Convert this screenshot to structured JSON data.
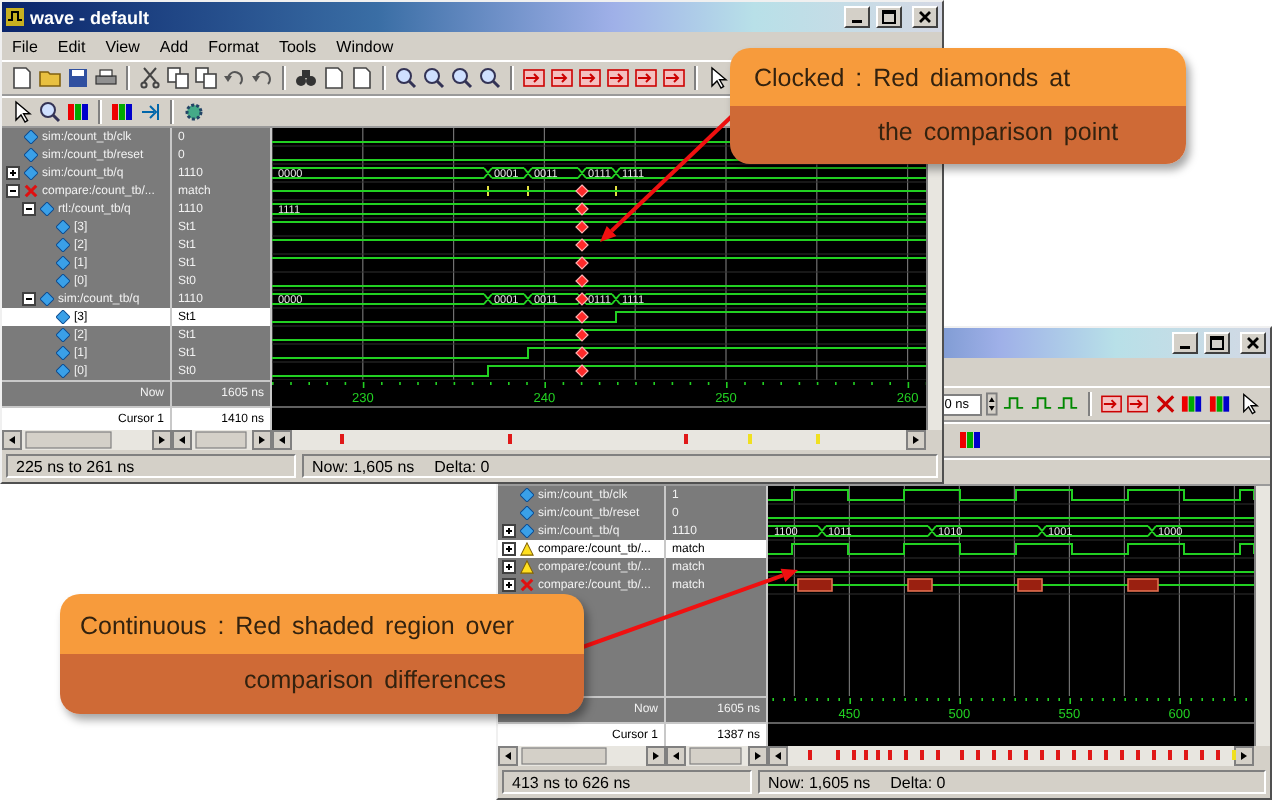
{
  "windows": [
    {
      "kind": "front",
      "title": "wave - default",
      "menu": [
        "File",
        "Edit",
        "View",
        "Add",
        "Format",
        "Tools",
        "Window"
      ],
      "signals": [
        {
          "name": "sim:/count_tb/clk",
          "value": "0",
          "kind": "signal",
          "selected": false
        },
        {
          "name": "sim:/count_tb/reset",
          "value": "0",
          "kind": "signal",
          "selected": false
        },
        {
          "name": "sim:/count_tb/q",
          "value": "1110",
          "kind": "signal",
          "expanded": false,
          "selected": false,
          "wave_labels": [
            "0000",
            "0001",
            "0011",
            "0111",
            "1111"
          ]
        },
        {
          "name": "compare:/count_tb/...",
          "value": "match",
          "kind": "error",
          "expanded": true,
          "selected": false,
          "children": [
            {
              "name": "rtl:/count_tb/q",
              "value": "1110",
              "kind": "signal",
              "expanded": true,
              "selected": false,
              "wave_labels": [
                "1111"
              ],
              "children": [
                {
                  "name": "[3]",
                  "value": "St1",
                  "kind": "signal",
                  "selected": false
                },
                {
                  "name": "[2]",
                  "value": "St1",
                  "kind": "signal",
                  "selected": false
                },
                {
                  "name": "[1]",
                  "value": "St1",
                  "kind": "signal",
                  "selected": false
                },
                {
                  "name": "[0]",
                  "value": "St0",
                  "kind": "signal",
                  "selected": false
                }
              ]
            },
            {
              "name": "sim:/count_tb/q",
              "value": "1110",
              "kind": "signal",
              "expanded": true,
              "selected": false,
              "wave_labels": [
                "0000",
                "0001",
                "0011",
                "0111",
                "1111"
              ],
              "children": [
                {
                  "name": "[3]",
                  "value": "St1",
                  "kind": "signal",
                  "selected": true
                },
                {
                  "name": "[2]",
                  "value": "St1",
                  "kind": "signal",
                  "selected": false
                },
                {
                  "name": "[1]",
                  "value": "St1",
                  "kind": "signal",
                  "selected": false
                },
                {
                  "name": "[0]",
                  "value": "St0",
                  "kind": "signal",
                  "selected": false
                }
              ]
            }
          ]
        }
      ],
      "now_label": "Now",
      "now": "1605 ns",
      "cursor_label": "Cursor 1",
      "cursor": "1410 ns",
      "axis": [
        "230",
        "240",
        "250",
        "260"
      ],
      "status": {
        "range": "225 ns to 261 ns",
        "now": "Now: 1,605 ns",
        "delta": "Delta: 0"
      }
    },
    {
      "kind": "back",
      "toolbar_field": "0 ns",
      "signals": [
        {
          "name": "sim:/count_tb/clk",
          "value": "1",
          "kind": "signal",
          "selected": false
        },
        {
          "name": "sim:/count_tb/reset",
          "value": "0",
          "kind": "signal",
          "selected": false
        },
        {
          "name": "sim:/count_tb/q",
          "value": "1110",
          "kind": "signal",
          "expanded": false,
          "selected": false,
          "wave_labels": [
            "1100",
            "1011",
            "1010",
            "1001",
            "1000"
          ]
        },
        {
          "name": "compare:/count_tb/...",
          "value": "match",
          "kind": "warning",
          "expanded": false,
          "selected": true
        },
        {
          "name": "compare:/count_tb/...",
          "value": "match",
          "kind": "warning",
          "expanded": false,
          "selected": false
        },
        {
          "name": "compare:/count_tb/...",
          "value": "match",
          "kind": "error",
          "expanded": false,
          "selected": false
        }
      ],
      "now_label": "Now",
      "now": "1605 ns",
      "cursor_label": "Cursor 1",
      "cursor": "1387 ns",
      "axis": [
        "450",
        "500",
        "550",
        "600"
      ],
      "status": {
        "range": "413 ns to 626 ns",
        "now": "Now: 1,605 ns",
        "delta": "Delta: 0"
      }
    }
  ],
  "callouts": [
    {
      "lines": [
        "Clocked : Red diamonds at",
        "the comparison point"
      ]
    },
    {
      "lines": [
        "Continuous : Red shaded region over",
        "comparison differences"
      ]
    }
  ]
}
